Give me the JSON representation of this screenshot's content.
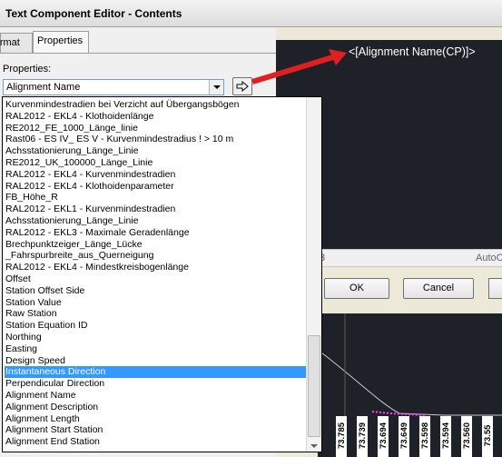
{
  "window": {
    "title": "Text Component Editor - Contents"
  },
  "tabs": [
    {
      "label": "Format"
    },
    {
      "label": "Properties"
    }
  ],
  "properties": {
    "label": "Properties:",
    "selected": "Alignment Name",
    "insert_icon": "arrow-right-icon"
  },
  "dropdown": {
    "highlighted": "Instantaneous Direction",
    "items": [
      "Kurvenmindestradien bei Verzicht auf Übergangsbögen",
      "RAL2012 - EKL4 - Klothoidenlänge",
      "RE2012_FE_1000_Länge_linie",
      "Rast06 - ES IV_ ES V - Kurvenmindestradius ! > 10 m",
      "Achsstationierung_Länge_Linie",
      "RE2012_UK_100000_Länge_Linie",
      "RAL2012 - EKL4 - Kurvenmindestradien",
      "RAL2012 - EKL4 - Klothoidenparameter",
      "FB_Höhe_R",
      "RAL2012 - EKL1 - Kurvenmindestradien",
      "Achsstationierung_Länge_Linie",
      "RAL2012 - EKL3 - Maximale Geradenlänge",
      "Brechpunktzeiger_Länge_Lücke",
      "_Fahrspurbreite_aus_Querneigung",
      "RAL2012 - EKL4 - Mindestkreisbogenlänge",
      "Offset",
      "Station Offset Side",
      "Station Value",
      "Raw Station",
      "Station Equation ID",
      "Northing",
      "Easting",
      "Design Speed",
      "Instantaneous Direction",
      "Perpendicular Direction",
      "Alignment Name",
      "Alignment Description",
      "Alignment Length",
      "Alignment Start Station",
      "Alignment End Station"
    ]
  },
  "preview": {
    "text": "<[Alignment Name(CP)]>"
  },
  "strip": {
    "left": "3",
    "right": "AutoC"
  },
  "buttons": {
    "ok": "OK",
    "cancel": "Cancel"
  },
  "tick_labels": [
    "73.785",
    "73.739",
    "73.694",
    "73.649",
    "73.598",
    "73.594",
    "73.560",
    "73.55"
  ],
  "colors": {
    "selection": "#3399ff",
    "dark_bg": "#1e2228",
    "arrow": "#e02020"
  }
}
